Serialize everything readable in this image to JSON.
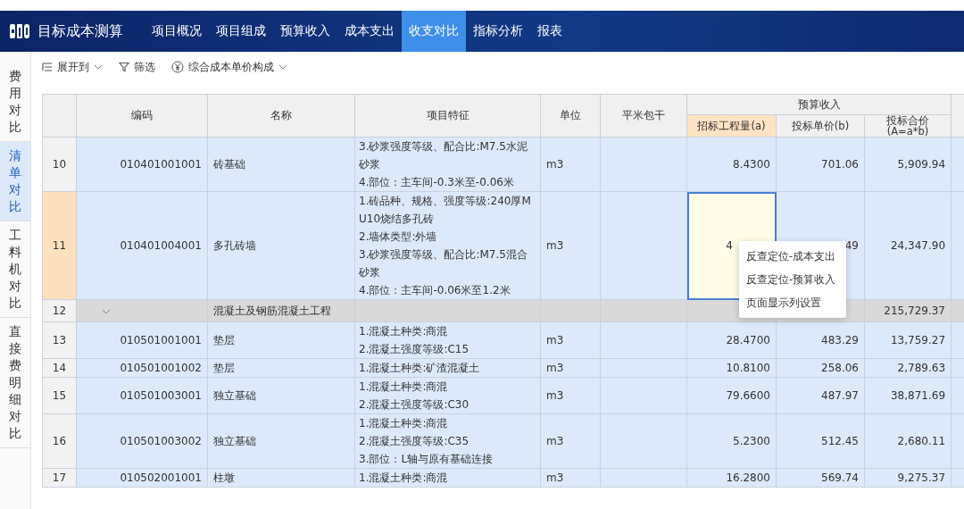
{
  "app": {
    "title": "目标成本测算"
  },
  "nav_tabs": [
    {
      "label": "项目概况",
      "selected": false
    },
    {
      "label": "项目组成",
      "selected": false
    },
    {
      "label": "预算收入",
      "selected": false
    },
    {
      "label": "成本支出",
      "selected": false
    },
    {
      "label": "收支对比",
      "selected": true
    },
    {
      "label": "指标分析",
      "selected": false
    },
    {
      "label": "报表",
      "selected": false
    }
  ],
  "side_tabs": [
    {
      "label": "费用对比",
      "selected": false
    },
    {
      "label": "清单对比",
      "selected": true
    },
    {
      "label": "工料机对比",
      "selected": false
    },
    {
      "label": "直接费明细对比",
      "selected": false
    }
  ],
  "toolbar": [
    {
      "kind": "expand",
      "label": "展开到",
      "dropdown": true
    },
    {
      "kind": "filter",
      "label": "筛选",
      "dropdown": false
    },
    {
      "kind": "price",
      "label": "综合成本单价构成",
      "dropdown": true
    }
  ],
  "table": {
    "columns": [
      "编码",
      "名称",
      "项目特征",
      "单位",
      "平米包干"
    ],
    "group_header": "预算收入",
    "sub_columns": [
      {
        "label": "招标工程量(a)",
        "selected": true
      },
      {
        "label": "投标单价(b)",
        "selected": false
      },
      {
        "label": "投标合价\n(A=a*b)",
        "selected": false
      }
    ],
    "rows": [
      {
        "kind": "item",
        "num": "10",
        "code": "010401001001",
        "name": "砖基础",
        "features": [
          "3.砂浆强度等级、配合比:M7.5水泥砂浆",
          "4.部位：主车间-0.3米至-0.06米"
        ],
        "unit": "m3",
        "qty": "8.4300",
        "price": "701.06",
        "total": "5,909.94",
        "selected": false
      },
      {
        "kind": "item",
        "num": "11",
        "code": "010401004001",
        "name": "多孔砖墙",
        "features": [
          "1.砖品种、规格、强度等级:240厚MU10烧结多孔砖",
          "2.墙体类型:外墙",
          "3.砂浆强度等级、配合比:M7.5混合砂浆",
          "4.部位：主车间-0.06米至1.2米"
        ],
        "unit": "m3",
        "qty": "4",
        "price": "49",
        "total": "24,347.90",
        "selected": true
      },
      {
        "kind": "group",
        "num": "12",
        "expanded": true,
        "name": "混凝土及钢筋混凝土工程",
        "total": "215,729.37"
      },
      {
        "kind": "item",
        "num": "13",
        "code": "010501001001",
        "name": "垫层",
        "features": [
          "1.混凝土种类:商混",
          "2.混凝土强度等级:C15"
        ],
        "unit": "m3",
        "qty": "28.4700",
        "price": "483.29",
        "total": "13,759.27",
        "selected": false
      },
      {
        "kind": "item",
        "num": "14",
        "code": "010501001002",
        "name": "垫层",
        "features": [
          "1.混凝土种类:矿渣混凝土"
        ],
        "unit": "m3",
        "qty": "10.8100",
        "price": "258.06",
        "total": "2,789.63",
        "selected": false
      },
      {
        "kind": "item",
        "num": "15",
        "code": "010501003001",
        "name": "独立基础",
        "features": [
          "1.混凝土种类:商混",
          "2.混凝土强度等级:C30"
        ],
        "unit": "m3",
        "qty": "79.6600",
        "price": "487.97",
        "total": "38,871.69",
        "selected": false
      },
      {
        "kind": "item",
        "num": "16",
        "code": "010501003002",
        "name": "独立基础",
        "features": [
          "1.混凝土种类:商混",
          "2.混凝土强度等级:C35",
          "3.部位：L轴与原有基础连接"
        ],
        "unit": "m3",
        "qty": "5.2300",
        "price": "512.45",
        "total": "2,680.11",
        "selected": false
      },
      {
        "kind": "item",
        "num": "17",
        "code": "010502001001",
        "name": "柱墩",
        "features": [
          "1.混凝土种类:商混"
        ],
        "unit": "m3",
        "qty": "16.2800",
        "price": "569.74",
        "total": "9,275.37",
        "selected": false
      }
    ]
  },
  "context_menu": [
    "反查定位-成本支出",
    "反查定位-预算收入",
    "页面显示列设置"
  ]
}
